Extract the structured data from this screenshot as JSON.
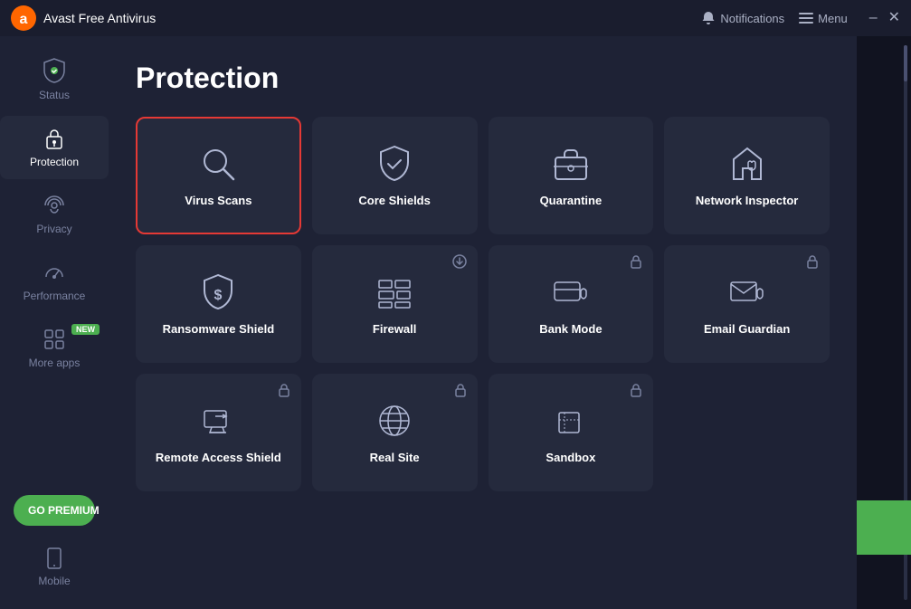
{
  "app": {
    "title": "Avast Free Antivirus",
    "notifications_label": "Notifications",
    "menu_label": "Menu"
  },
  "sidebar": {
    "items": [
      {
        "id": "status",
        "label": "Status",
        "icon": "shield"
      },
      {
        "id": "protection",
        "label": "Protection",
        "icon": "lock",
        "active": true
      },
      {
        "id": "privacy",
        "label": "Privacy",
        "icon": "fingerprint"
      },
      {
        "id": "performance",
        "label": "Performance",
        "icon": "gauge"
      },
      {
        "id": "more-apps",
        "label": "More apps",
        "icon": "grid",
        "badge": "NEW"
      }
    ],
    "go_premium": "GO PREMIUM",
    "mobile_label": "Mobile"
  },
  "page": {
    "title": "Protection"
  },
  "tiles": [
    {
      "id": "virus-scans",
      "label": "Virus Scans",
      "icon": "search",
      "selected": true
    },
    {
      "id": "core-shields",
      "label": "Core Shields",
      "icon": "shield-check"
    },
    {
      "id": "quarantine",
      "label": "Quarantine",
      "icon": "briefcase"
    },
    {
      "id": "network-inspector",
      "label": "Network Inspector",
      "icon": "house-shield"
    },
    {
      "id": "ransomware-shield",
      "label": "Ransomware Shield",
      "icon": "dollar-shield"
    },
    {
      "id": "firewall",
      "label": "Firewall",
      "icon": "bricks",
      "badge": "download"
    },
    {
      "id": "bank-mode",
      "label": "Bank Mode",
      "icon": "card-shield",
      "lock": true
    },
    {
      "id": "email-guardian",
      "label": "Email Guardian",
      "icon": "email-shield",
      "lock": true
    },
    {
      "id": "remote-access-shield",
      "label": "Remote Access Shield",
      "icon": "remote",
      "lock": true
    },
    {
      "id": "real-site",
      "label": "Real Site",
      "icon": "globe",
      "lock": true
    },
    {
      "id": "sandbox",
      "label": "Sandbox",
      "icon": "box",
      "lock": true
    }
  ]
}
